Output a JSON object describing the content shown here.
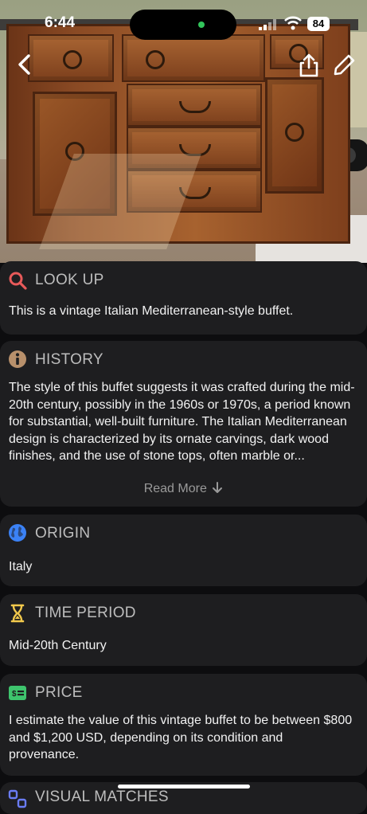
{
  "status_bar": {
    "time": "6:44",
    "battery": "84"
  },
  "cards": [
    {
      "title": "LOOK UP",
      "icon": "search-icon",
      "icon_color": "#e85a5a",
      "body": "This is a vintage Italian Mediterranean-style buffet."
    },
    {
      "title": "HISTORY",
      "icon": "info-icon",
      "icon_color": "#b8906b",
      "body": "The style of this buffet suggests it was crafted during the mid-20th century, possibly in the 1960s or 1970s, a period known for substantial, well-built furniture. The Italian Mediterranean design is characterized by its ornate carvings, dark wood finishes, and the use of stone tops, often marble or...",
      "read_more": "Read More"
    },
    {
      "title": "ORIGIN",
      "icon": "globe-icon",
      "icon_color": "#3b82f6",
      "body": "Italy"
    },
    {
      "title": "TIME PERIOD",
      "icon": "hourglass-icon",
      "icon_color": "#f2c94c",
      "body": "Mid-20th Century"
    },
    {
      "title": "PRICE",
      "icon": "money-icon",
      "icon_color": "#3ec46d",
      "body": "I estimate the value of this vintage buffet to be between $800 and $1,200 USD, depending on its condition and provenance."
    },
    {
      "title": "VISUAL MATCHES",
      "icon": "image-match-icon",
      "icon_color": "#6a7cf5"
    }
  ]
}
